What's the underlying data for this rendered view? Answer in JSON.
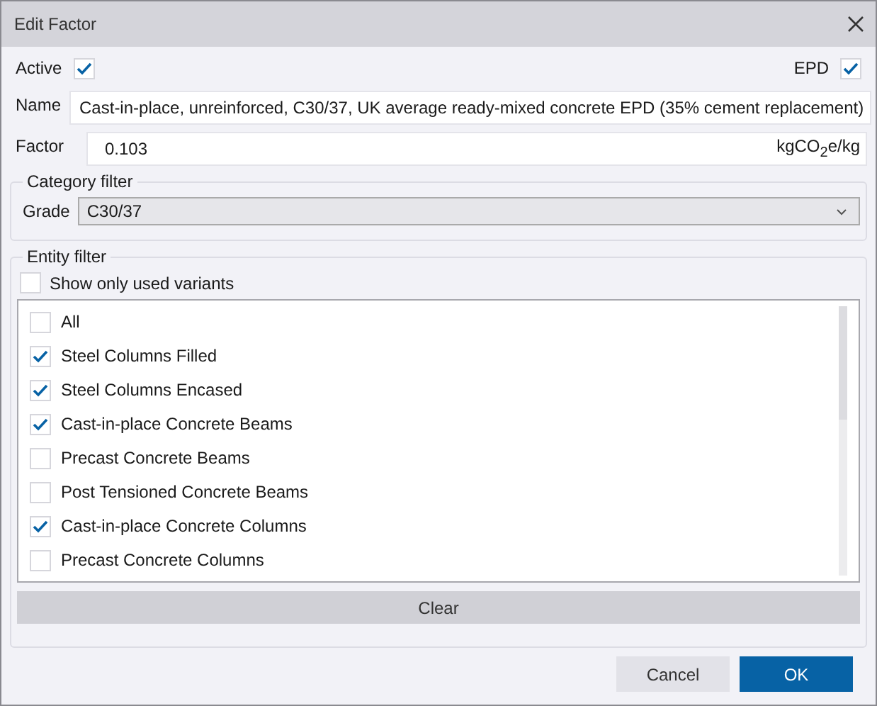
{
  "window": {
    "title": "Edit Factor"
  },
  "active": {
    "label": "Active",
    "checked": true
  },
  "epd": {
    "label": "EPD",
    "checked": true
  },
  "name": {
    "label": "Name",
    "value": "Cast-in-place, unreinforced, C30/37, UK average ready-mixed concrete EPD (35% cement replacement)"
  },
  "factor": {
    "label": "Factor",
    "value": "0.103",
    "unit": "kgCO$_{2}$e/kg"
  },
  "category_filter": {
    "title": "Category filter",
    "grade": {
      "label": "Grade",
      "value": "C30/37"
    }
  },
  "entity_filter": {
    "title": "Entity filter",
    "show_only_used": {
      "label": "Show only used variants",
      "checked": false
    },
    "items": [
      {
        "label": "All",
        "checked": false
      },
      {
        "label": "Steel Columns Filled",
        "checked": true
      },
      {
        "label": "Steel Columns Encased",
        "checked": true
      },
      {
        "label": "Cast-in-place Concrete Beams",
        "checked": true
      },
      {
        "label": "Precast Concrete Beams",
        "checked": false
      },
      {
        "label": "Post Tensioned Concrete Beams",
        "checked": false
      },
      {
        "label": "Cast-in-place Concrete Columns",
        "checked": true
      },
      {
        "label": "Precast Concrete Columns",
        "checked": false
      }
    ],
    "clear_button": "Clear"
  },
  "buttons": [
    {
      "label": "Cancel",
      "kind": "secondary"
    },
    {
      "label": "OK",
      "kind": "primary"
    }
  ]
}
